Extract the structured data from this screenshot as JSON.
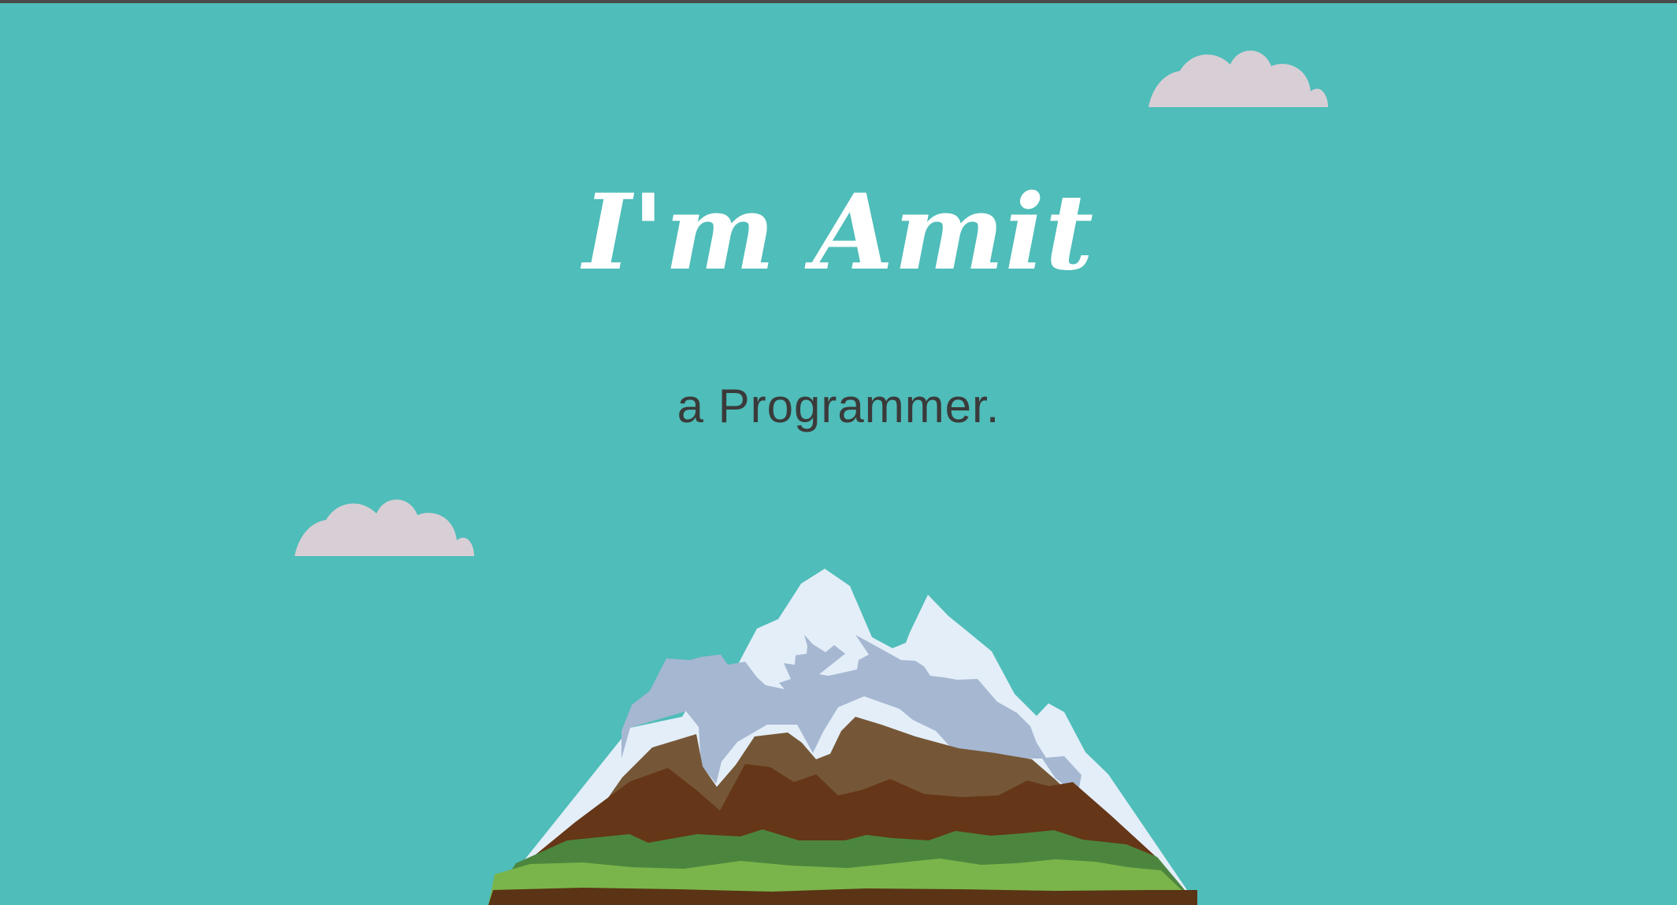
{
  "hero": {
    "title": "I'm Amit",
    "subtitle": "a Programmer."
  },
  "decorations": {
    "cloud_top_right": "cloud-icon",
    "cloud_left": "cloud-icon",
    "mountain": "mountain-illustration"
  },
  "colors": {
    "background": "#4fbdb9",
    "title": "#ffffff",
    "subtitle": "#3a3a3a",
    "cloud": "#d8cfd6",
    "snow": "#e3eef8",
    "snow_shadow": "#a5b7d1",
    "rock_light": "#755737",
    "rock_dark": "#653617",
    "grass_dark": "#4c863e",
    "grass_light": "#7ab54b",
    "soil": "#5a3414"
  }
}
